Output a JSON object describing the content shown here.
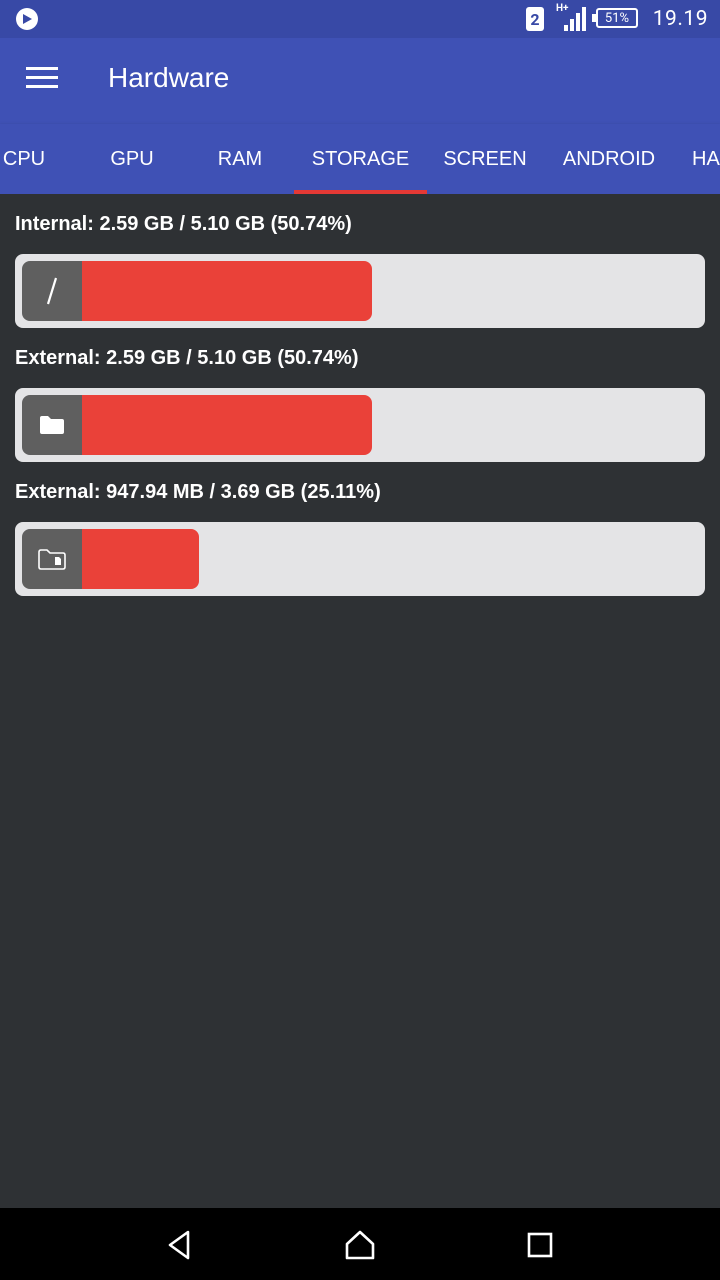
{
  "status_bar": {
    "sim_slot": "2",
    "network_type": "H+",
    "battery": "51%",
    "time": "19.19",
    "icons": [
      "play-store-icon",
      "sim-icon",
      "signal-icon",
      "battery-icon"
    ]
  },
  "app_bar": {
    "title": "Hardware",
    "menu_icon": "hamburger-menu-icon"
  },
  "tabs": [
    {
      "label": "CPU",
      "active": false
    },
    {
      "label": "GPU",
      "active": false
    },
    {
      "label": "RAM",
      "active": false
    },
    {
      "label": "STORAGE",
      "active": true
    },
    {
      "label": "SCREEN",
      "active": false
    },
    {
      "label": "ANDROID",
      "active": false
    },
    {
      "label": "HA",
      "active": false
    }
  ],
  "storage": [
    {
      "label": "Internal: 2.59 GB / 5.10 GB (50.74%)",
      "icon": "root-slash-icon",
      "used_percent": 50.74
    },
    {
      "label": "External: 2.59 GB / 5.10 GB (50.74%)",
      "icon": "folder-icon",
      "used_percent": 50.74
    },
    {
      "label": "External: 947.94 MB / 3.69 GB (25.11%)",
      "icon": "sd-card-folder-icon",
      "used_percent": 25.11
    }
  ],
  "colors": {
    "primary": "#3f51b5",
    "primary_dark": "#3849a6",
    "accent": "#e53935",
    "bar_fill": "#ea4139",
    "background": "#2e3134",
    "track": "#e4e4e6"
  },
  "nav_bar": {
    "buttons": [
      "back-icon",
      "home-icon",
      "recents-icon"
    ]
  }
}
